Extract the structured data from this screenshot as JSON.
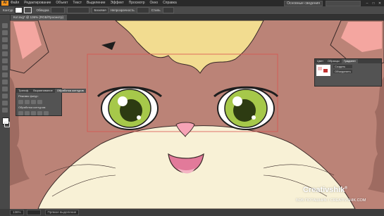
{
  "menubar": {
    "logo": "Ai",
    "items": [
      "Файл",
      "Редактирование",
      "Объект",
      "Текст",
      "Выделение",
      "Эффект",
      "Просмотр",
      "Окно",
      "Справка"
    ],
    "workspace": "Основные сведения"
  },
  "control_bar": {
    "object_label": "Контур",
    "stroke_label": "Обводка",
    "brush_value": "Базовая",
    "opacity_label": "Непрозрачность",
    "style_label": "Стиль"
  },
  "document_tab": {
    "title": "Кот.svg* @ 136% (RGB/Просмотр)"
  },
  "align_panel": {
    "tabs": [
      "Трансф.",
      "Выравнивание",
      "Обработка контуров"
    ],
    "row1_label": "Режимы фигур:",
    "row2_label": "Обработка контуров:"
  },
  "pathfinder_panel": {
    "tabs": [
      "Цвет",
      "Образцы",
      "Градиент"
    ],
    "options": [
      "Создать",
      "Объединить"
    ]
  },
  "watermark": {
    "brand": "Creativshik",
    "reg_mark": "®",
    "subtitle": "БОБ ПОТАШНИК / CREATIVSHIK.COM"
  },
  "statusbar": {
    "zoom": "136%",
    "tool_name": "Прямое выделение"
  },
  "colors": {
    "fur": "#bb8377",
    "cream": "#f8f1d6",
    "hair": "#f2dc90",
    "eye_green": "#a6c84a",
    "nose": "#f7a3b6",
    "mouth": "#e27a9a",
    "ear_inner": "#f4a6a0",
    "selection": "#d9534f",
    "ui_dark": "#3a3a3a",
    "ui_accent": "#f7941d"
  },
  "icons": [
    "ai-logo-icon",
    "selection-tool-icon",
    "direct-selection-icon",
    "pen-icon",
    "type-icon",
    "line-icon",
    "rectangle-icon",
    "brush-icon",
    "pencil-icon",
    "rotate-icon",
    "scale-icon",
    "eyedropper-icon",
    "hand-icon",
    "zoom-icon",
    "minimize-icon",
    "maximize-icon",
    "close-icon"
  ]
}
